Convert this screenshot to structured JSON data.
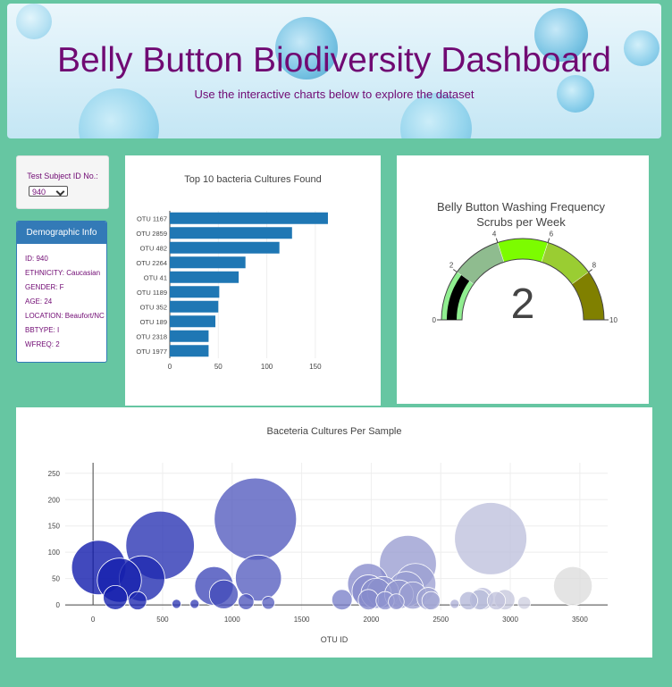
{
  "header": {
    "title": "Belly Button Biodiversity Dashboard",
    "subtitle": "Use the interactive charts below to explore the dataset"
  },
  "selector": {
    "label": "Test Subject ID No.:",
    "selected": "940"
  },
  "demographic": {
    "heading": "Demographic Info",
    "lines": [
      "ID: 940",
      "ETHNICITY: Caucasian",
      "GENDER: F",
      "AGE: 24",
      "LOCATION: Beaufort/NC",
      "BBTYPE: I",
      "WFREQ: 2"
    ]
  },
  "colors": {
    "background": "#66c6a2",
    "title": "#700a73",
    "bar": "#1f77b4",
    "panel_header": "#337ab7"
  },
  "chart_data": [
    {
      "type": "bar",
      "orientation": "horizontal",
      "title": "Top 10 bacteria Cultures Found",
      "categories": [
        "OTU 1167",
        "OTU 2859",
        "OTU 482",
        "OTU 2264",
        "OTU 41",
        "OTU 1189",
        "OTU 352",
        "OTU 189",
        "OTU 2318",
        "OTU 1977"
      ],
      "values": [
        163,
        126,
        113,
        78,
        71,
        51,
        50,
        47,
        40,
        40
      ],
      "xticks": [
        0,
        50,
        100,
        150
      ],
      "xlim": [
        0,
        175
      ]
    },
    {
      "type": "gauge",
      "title": "Belly Button Washing Frequency",
      "subtitle": "Scrubs per Week",
      "value": 2,
      "range": [
        0,
        10
      ],
      "ticks": [
        0,
        2,
        4,
        6,
        8,
        10
      ],
      "steps": [
        {
          "range": [
            0,
            2
          ],
          "color": "#90ee90"
        },
        {
          "range": [
            2,
            4
          ],
          "color": "#8fbc8f"
        },
        {
          "range": [
            4,
            6
          ],
          "color": "#7cfc00"
        },
        {
          "range": [
            6,
            8
          ],
          "color": "#9acd32"
        },
        {
          "range": [
            8,
            10
          ],
          "color": "#808000"
        }
      ],
      "bar_color": "#000000"
    },
    {
      "type": "scatter",
      "title": "Baceteria Cultures Per Sample",
      "xlabel": "OTU ID",
      "xlim": [
        -200,
        3700
      ],
      "ylim": [
        -10,
        270
      ],
      "xticks": [
        0,
        500,
        1000,
        1500,
        2000,
        2500,
        3000,
        3500
      ],
      "yticks": [
        0,
        50,
        100,
        150,
        200,
        250
      ],
      "points": [
        {
          "x": 41,
          "y": 71
        },
        {
          "x": 189,
          "y": 47
        },
        {
          "x": 352,
          "y": 50
        },
        {
          "x": 482,
          "y": 113
        },
        {
          "x": 1167,
          "y": 163
        },
        {
          "x": 1189,
          "y": 51
        },
        {
          "x": 2264,
          "y": 78
        },
        {
          "x": 2318,
          "y": 40
        },
        {
          "x": 2859,
          "y": 126
        },
        {
          "x": 1977,
          "y": 40
        },
        {
          "x": 870,
          "y": 36
        },
        {
          "x": 940,
          "y": 20
        },
        {
          "x": 1980,
          "y": 26
        },
        {
          "x": 2035,
          "y": 22
        },
        {
          "x": 2085,
          "y": 24
        },
        {
          "x": 2200,
          "y": 20
        },
        {
          "x": 2250,
          "y": 30
        },
        {
          "x": 2300,
          "y": 18
        },
        {
          "x": 1980,
          "y": 10
        },
        {
          "x": 3450,
          "y": 36
        },
        {
          "x": 160,
          "y": 14
        },
        {
          "x": 320,
          "y": 8
        },
        {
          "x": 2700,
          "y": 8
        },
        {
          "x": 2780,
          "y": 10
        },
        {
          "x": 2800,
          "y": 12
        },
        {
          "x": 2900,
          "y": 8
        },
        {
          "x": 2960,
          "y": 10
        },
        {
          "x": 2410,
          "y": 12
        },
        {
          "x": 2430,
          "y": 8
        },
        {
          "x": 1790,
          "y": 10
        },
        {
          "x": 2100,
          "y": 8
        },
        {
          "x": 2180,
          "y": 6
        },
        {
          "x": 1100,
          "y": 6
        },
        {
          "x": 1260,
          "y": 4
        },
        {
          "x": 730,
          "y": 2
        },
        {
          "x": 600,
          "y": 2
        },
        {
          "x": 2600,
          "y": 2
        },
        {
          "x": 3100,
          "y": 4
        }
      ]
    }
  ]
}
